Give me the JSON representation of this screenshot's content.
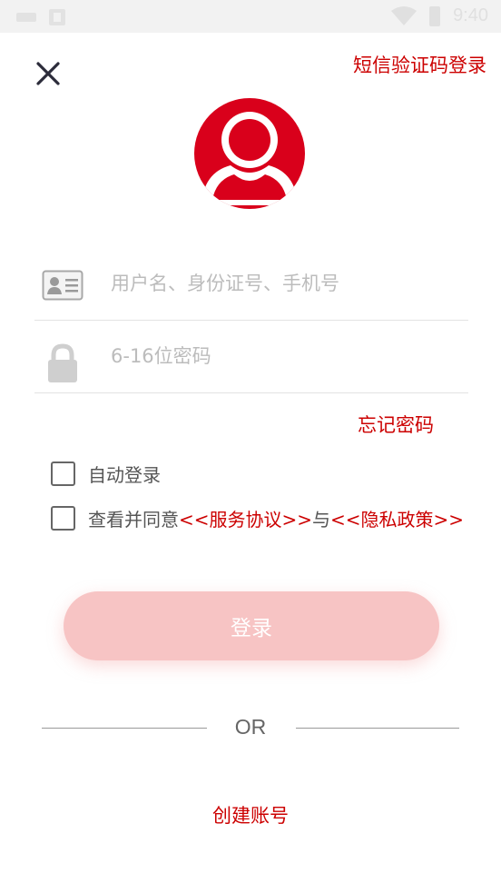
{
  "status_bar": {
    "time": "9:40"
  },
  "header": {
    "sms_login_label": "短信验证码登录"
  },
  "form": {
    "username_placeholder": "用户名、身份证号、手机号",
    "password_placeholder": "6-16位密码",
    "forgot_label": "忘记密码",
    "auto_login_label": "自动登录",
    "agree_prefix": "查看并同意",
    "service_agreement_link": "<<服务协议>>",
    "agree_joiner": "与",
    "privacy_policy_link": "<<隐私政策>>",
    "login_label": "登录"
  },
  "divider": {
    "or_label": "OR"
  },
  "footer": {
    "create_account_label": "创建账号"
  },
  "colors": {
    "accent": "#cc0000",
    "avatar": "#d9001b",
    "login_button": "#f7c4c4"
  },
  "icons": {
    "close": "close-icon",
    "avatar": "avatar-icon",
    "id_card": "id-card-icon",
    "lock": "lock-icon",
    "wifi": "wifi-icon",
    "battery": "battery-icon"
  }
}
